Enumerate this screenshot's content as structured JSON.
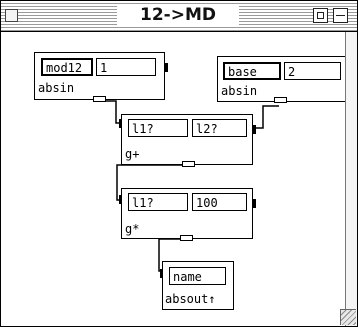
{
  "window": {
    "title": "12->MD"
  },
  "objects": {
    "mod12": {
      "field1": "mod12",
      "field2": "1",
      "label": "absin"
    },
    "base": {
      "field1": "base",
      "field2": "2",
      "label": "absin"
    },
    "gplus": {
      "field1": "l1?",
      "field2": "l2?",
      "label": "g+"
    },
    "gmult": {
      "field1": "l1?",
      "field2": "100",
      "label": "g*"
    },
    "absout": {
      "field1": "name",
      "label": "absout↑"
    }
  },
  "colors": {
    "background": "#ffffff",
    "ink": "#000000",
    "titlebar_stripe": "#9a9a9a"
  },
  "icons": [
    "close-box-icon",
    "zoom-box-icon",
    "collapse-box-icon",
    "grow-box-icon"
  ]
}
